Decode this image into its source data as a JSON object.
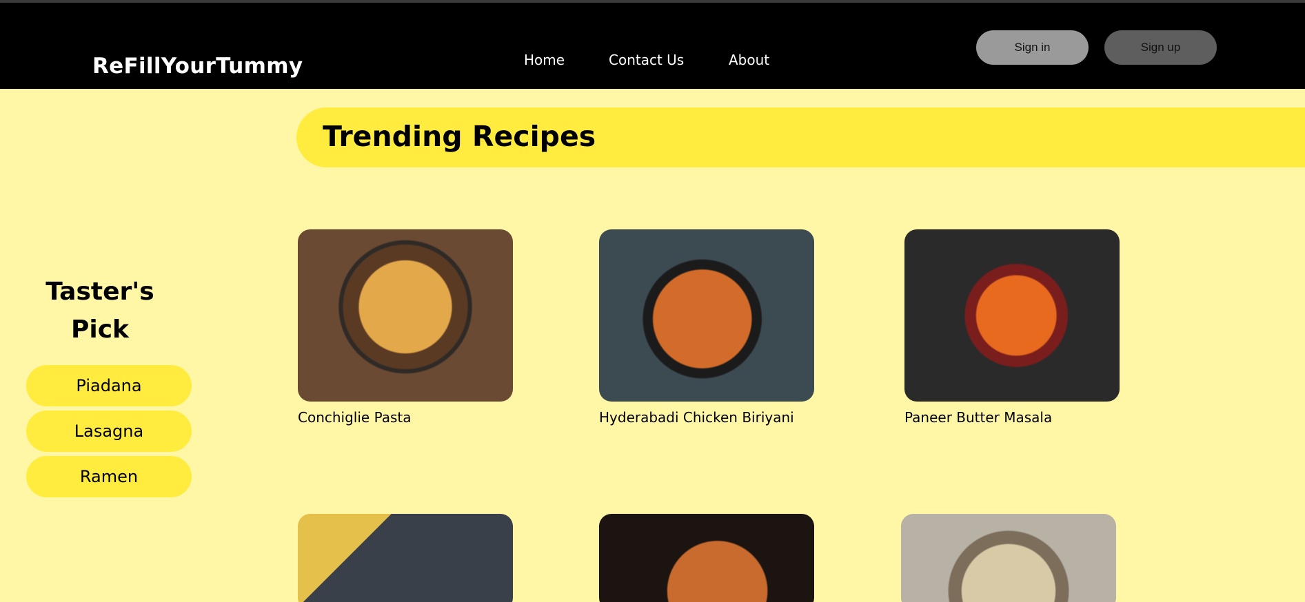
{
  "header": {
    "brand": "ReFillYourTummy",
    "nav": [
      "Home",
      "Contact Us",
      "About"
    ],
    "sign_in": "Sign in",
    "sign_up": "Sign up"
  },
  "banner": {
    "title": "Trending Recipes"
  },
  "tasters_pick": {
    "title": "Taster's Pick",
    "items": [
      "Piadana",
      "Lasagna",
      "Ramen"
    ]
  },
  "recipes": [
    {
      "name": "Conchiglie Pasta",
      "image": "pasta-photo"
    },
    {
      "name": "Hyderabadi Chicken Biriyani",
      "image": "biriyani-photo"
    },
    {
      "name": "Paneer Butter Masala",
      "image": "paneer-photo"
    },
    {
      "name": "",
      "image": "piadana-photo"
    },
    {
      "name": "",
      "image": "lasagna-photo"
    },
    {
      "name": "",
      "image": "ramen-photo"
    }
  ],
  "colors": {
    "background": "#fff7a6",
    "accent": "#ffec3f",
    "header": "#000000",
    "sign_in_bg": "#9a9a9a",
    "sign_up_bg": "#5e5e5e"
  }
}
